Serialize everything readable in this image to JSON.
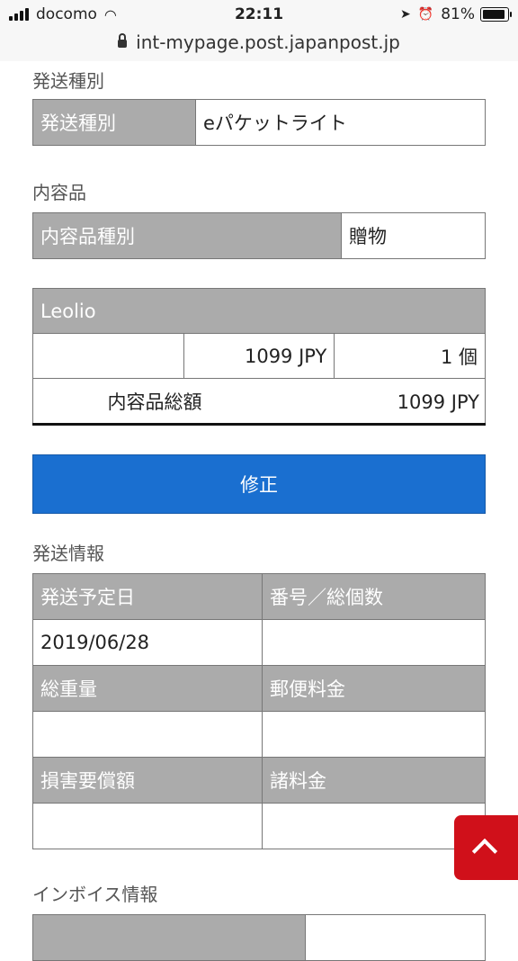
{
  "status": {
    "carrier": "docomo",
    "time": "22:11",
    "battery": "81%"
  },
  "url": "int-mypage.post.japanpost.jp",
  "shipping_type": {
    "heading": "発送種別",
    "label": "発送種別",
    "value": "eパケットライト"
  },
  "contents": {
    "heading": "内容品",
    "type_label": "内容品種別",
    "type_value": "贈物",
    "item_name": "Leolio",
    "item_desc": "",
    "item_price": "1099 JPY",
    "item_qty": "1 個",
    "total_label": "内容品総額",
    "total_value": "1099 JPY"
  },
  "edit_button": "修正",
  "shipping_info": {
    "heading": "発送情報",
    "date_label": "発送予定日",
    "date_value": "2019/06/28",
    "number_label": "番号／総個数",
    "number_value": "",
    "weight_label": "総重量",
    "weight_value": "",
    "postage_label": "郵便料金",
    "postage_value": "",
    "compensation_label": "損害要償額",
    "compensation_value": "",
    "fees_label": "諸料金",
    "fees_value": ""
  },
  "invoice": {
    "heading": "インボイス情報"
  }
}
